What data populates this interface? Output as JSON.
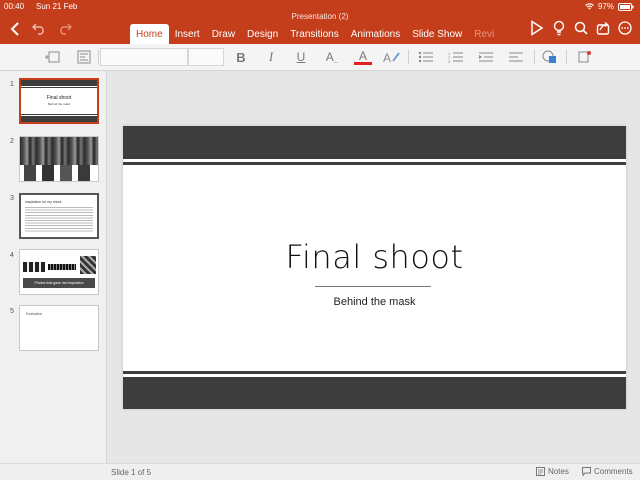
{
  "status_bar": {
    "time": "00:40",
    "date": "Sun 21 Feb",
    "battery": "97%"
  },
  "document": {
    "title": "Presentation (2)"
  },
  "tabs": [
    {
      "label": "Home",
      "active": true
    },
    {
      "label": "Insert"
    },
    {
      "label": "Draw"
    },
    {
      "label": "Design"
    },
    {
      "label": "Transitions"
    },
    {
      "label": "Animations"
    },
    {
      "label": "Slide Show"
    },
    {
      "label": "Revi"
    }
  ],
  "ribbon": {
    "bold": "B",
    "italic": "I",
    "underline": "U",
    "font_size_a": "A",
    "font_color_a": "A",
    "font_color_accent": "#e02020",
    "shape_fill": "#3a7fd0"
  },
  "thumbnails": [
    {
      "num": "1",
      "title": "Final shoot",
      "subtitle": "Behind the mask"
    },
    {
      "num": "2"
    },
    {
      "num": "3",
      "title": "Inspiration for my shoot"
    },
    {
      "num": "4",
      "caption": "Photos that gave me inspiration"
    },
    {
      "num": "5",
      "title": "Evaluation"
    }
  ],
  "slide": {
    "title": "Final shoot",
    "subtitle": "Behind the mask"
  },
  "bottom_bar": {
    "slide_counter": "Slide 1 of 5",
    "notes_label": "Notes",
    "comments_label": "Comments"
  },
  "colors": {
    "brand": "#c43e1c",
    "band": "#3d3d3d"
  }
}
